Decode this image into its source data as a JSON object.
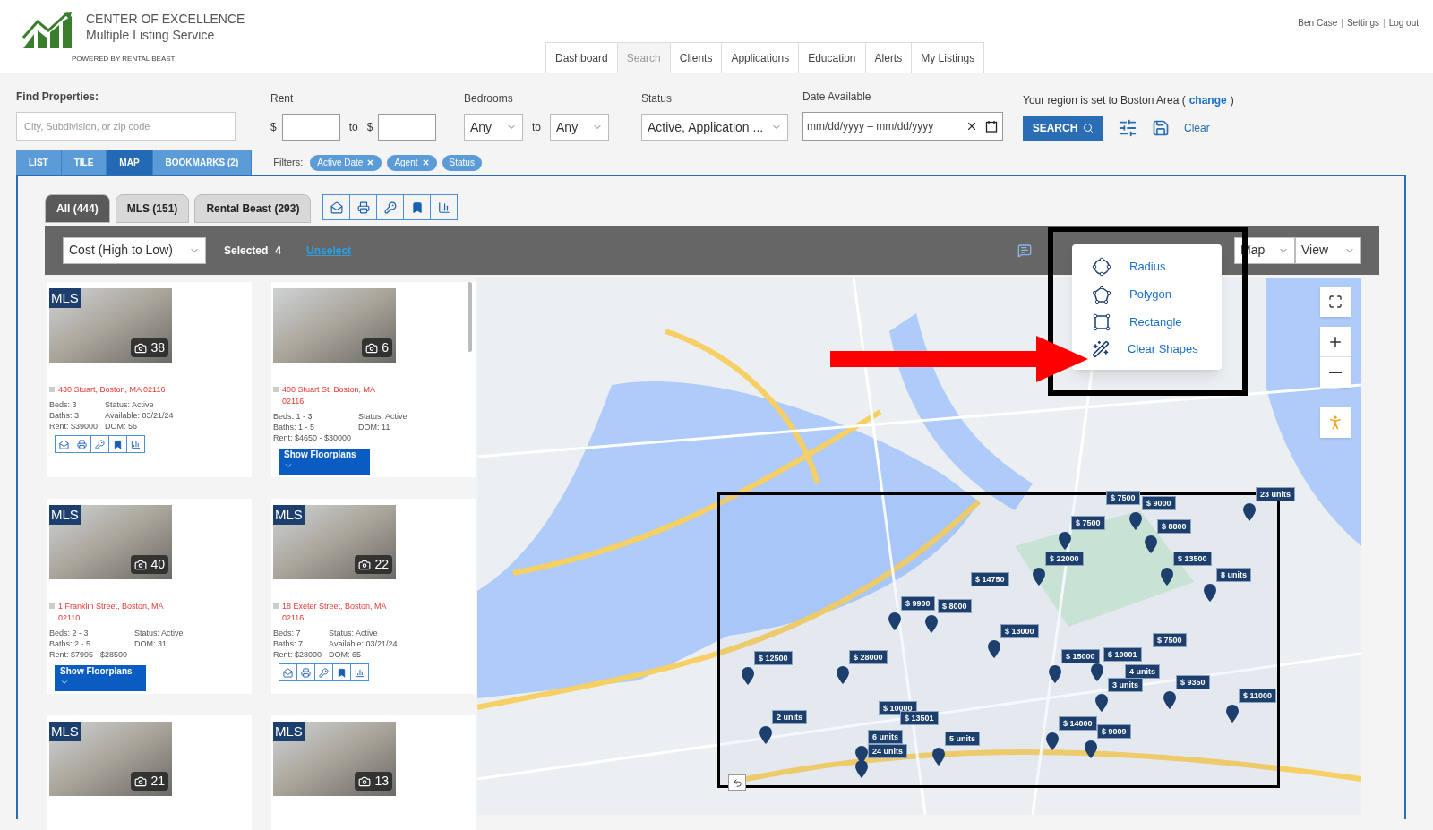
{
  "header": {
    "logo_title": "CENTER OF EXCELLENCE",
    "logo_subtitle": "Multiple Listing Service",
    "powered_by": "POWERED BY RENTAL BEAST",
    "user_links": [
      "Ben Case",
      "Settings",
      "Log out"
    ],
    "separators": [
      "|",
      "|"
    ]
  },
  "nav_tabs": [
    {
      "label": "Dashboard",
      "selected": false
    },
    {
      "label": "Search",
      "selected": true
    },
    {
      "label": "Clients",
      "selected": false
    },
    {
      "label": "Applications",
      "selected": false
    },
    {
      "label": "Education",
      "selected": false
    },
    {
      "label": "Alerts",
      "selected": false
    },
    {
      "label": "My Listings",
      "selected": false
    }
  ],
  "search": {
    "find_label": "Find Properties:",
    "find_placeholder": "City, Subdivision, or zip code",
    "rent_label": "Rent",
    "currency": "$",
    "rent_to": "to",
    "bedrooms_to_text": "to",
    "bedrooms_label": "Bedrooms",
    "bedrooms_from": "Any",
    "bedrooms_to": "Any",
    "status_label": "Status",
    "status_value": "Active, Application ...",
    "date_label": "Date Available",
    "date_placeholder": "mm/dd/yyyy – mm/dd/yyyy",
    "region_text": "Your region is set to Boston Area (",
    "region_link": "change",
    "region_close": ")",
    "search_button": "SEARCH",
    "clear_link": "Clear"
  },
  "view_tabs": [
    {
      "label": "LIST",
      "selected": false
    },
    {
      "label": "TILE",
      "selected": false
    },
    {
      "label": "MAP",
      "selected": true
    },
    {
      "label": "BOOKMARKS (2)",
      "selected": false
    }
  ],
  "filters": {
    "label": "Filters:",
    "chips": [
      {
        "label": "Active Date",
        "removable": true
      },
      {
        "label": "Agent",
        "removable": true
      },
      {
        "label": "Status",
        "removable": false
      }
    ]
  },
  "source_tabs": [
    {
      "label": "All (444)",
      "selected": true
    },
    {
      "label": "MLS (151)",
      "selected": false
    },
    {
      "label": "Rental Beast (293)",
      "selected": false
    }
  ],
  "toolbar": {
    "sort": "Cost (High to Low)",
    "selected_label": "Selected",
    "selected_count": "4",
    "unselect": "Unselect",
    "map_select": "Map",
    "view_select": "View"
  },
  "listings": [
    {
      "kind": "actions",
      "badge": "MLS",
      "checked": false,
      "photos": "38",
      "address": "430 Stuart, Boston, MA 02116",
      "left": [
        "Beds: 3",
        "Baths: 3",
        "Rent: $39000"
      ],
      "right": [
        "Status: Active",
        "Available: 03/21/24",
        "DOM: 56"
      ]
    },
    {
      "kind": "floorplans",
      "checked": false,
      "photos": "6",
      "address": "400 Stuart St, Boston, MA 02116",
      "left": [
        "Beds: 1 - 3",
        "Baths: 1 - 5",
        "Rent: $4650 - $30000"
      ],
      "right": [
        "Status: Active",
        "DOM: 11"
      ],
      "button": "Show Floorplans"
    },
    {
      "kind": "floorplans",
      "badge": "MLS",
      "checked": false,
      "photos": "40",
      "address": "1 Franklin Street, Boston, MA 02110",
      "left": [
        "Beds: 2 - 3",
        "Baths: 2 - 5",
        "Rent: $7995 - $28500"
      ],
      "right": [
        "Status: Active",
        "DOM: 31"
      ],
      "button": "Show Floorplans"
    },
    {
      "kind": "actions",
      "badge": "MLS",
      "checked": false,
      "photos": "22",
      "address": "18 Exeter Street, Boston, MA 02116",
      "left": [
        "Beds: 7",
        "Baths: 7",
        "Rent: $28000"
      ],
      "right": [
        "Status: Active",
        "Available: 03/21/24",
        "DOM: 65"
      ]
    },
    {
      "kind": "partial",
      "badge": "MLS",
      "photos": "21"
    },
    {
      "kind": "partial",
      "badge": "MLS",
      "photos": "13"
    }
  ],
  "draw_menu": [
    {
      "kind": "radius",
      "label": "Radius"
    },
    {
      "kind": "polygon",
      "label": "Polygon"
    },
    {
      "kind": "rectangle",
      "label": "Rectangle"
    },
    {
      "kind": "clear",
      "label": "Clear Shapes"
    }
  ],
  "map_markers": [
    "$ 7500",
    "$ 9000",
    "23 units",
    "$ 7500",
    "$ 8800",
    "$ 22000",
    "$ 13500",
    "8 units",
    "$ 14750",
    "$ 9900",
    "$ 8000",
    "$ 13000",
    "$ 12500",
    "$ 28000",
    "$ 15000",
    "$ 10001",
    "$ 7500",
    "4 units",
    "3 units",
    "$ 9350",
    "$ 11000",
    "$ 10000",
    "$ 13501",
    "2 units",
    "6 units",
    "24 units",
    "5 units",
    "$ 14000",
    "$ 9009"
  ]
}
